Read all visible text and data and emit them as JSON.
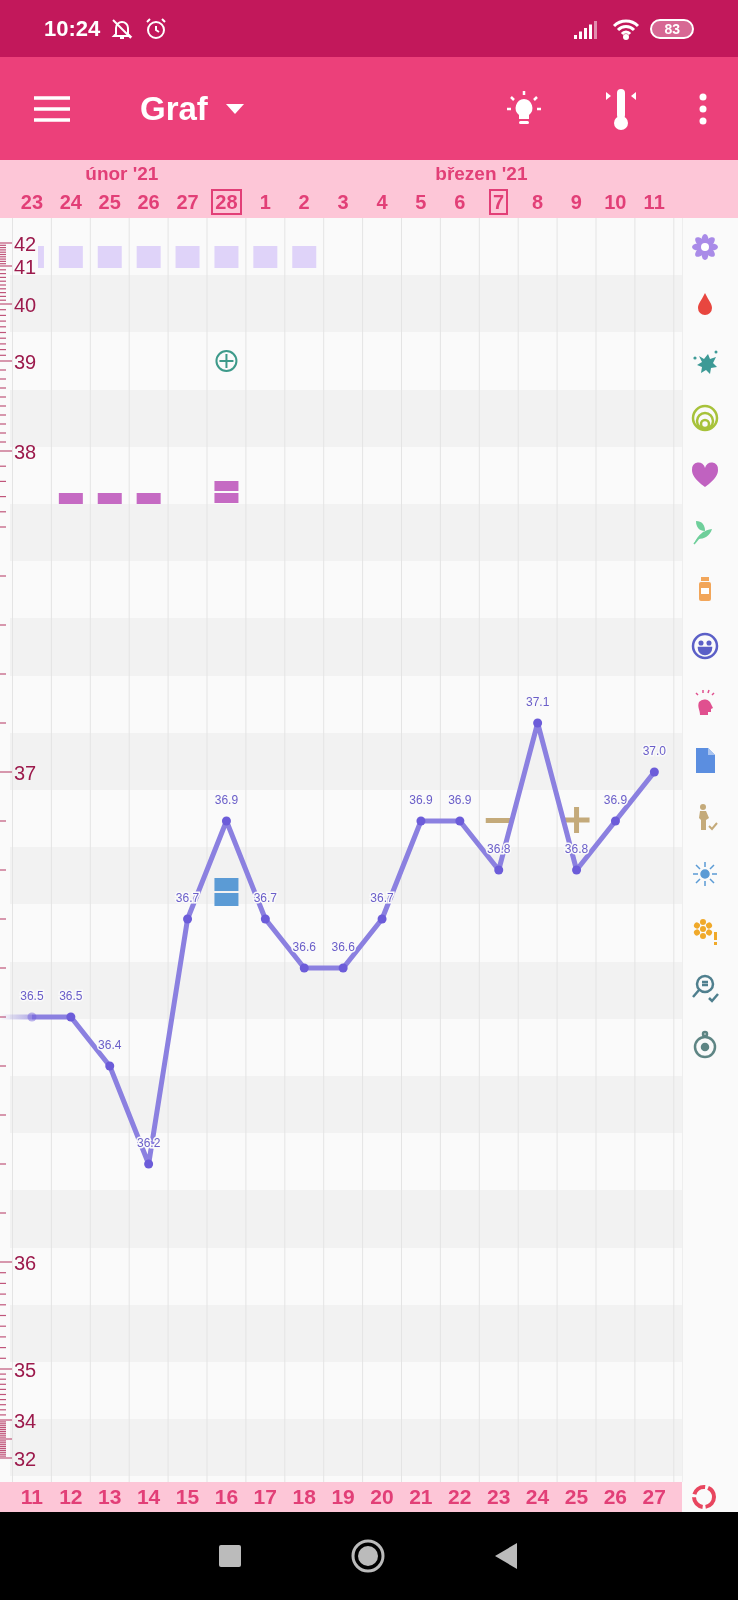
{
  "status_bar": {
    "time": "10:24",
    "battery": "83"
  },
  "app_bar": {
    "title": "Graf"
  },
  "chart": {
    "days": [
      {
        "date": "23",
        "highlighted": false,
        "symbols": [
          {
            "kind": "square"
          }
        ]
      },
      {
        "date": "24",
        "highlighted": false,
        "symbols": [
          {
            "kind": "square"
          },
          {
            "kind": "bar"
          }
        ]
      },
      {
        "date": "25",
        "month": "únor '21",
        "highlighted": false,
        "symbols": [
          {
            "kind": "square"
          },
          {
            "kind": "bar"
          }
        ]
      },
      {
        "date": "26",
        "highlighted": false,
        "symbols": [
          {
            "kind": "square"
          },
          {
            "kind": "bar"
          }
        ]
      },
      {
        "date": "27",
        "highlighted": false,
        "symbols": [
          {
            "kind": "square"
          }
        ]
      },
      {
        "date": "28",
        "highlighted": true,
        "symbols": [
          {
            "kind": "square"
          },
          {
            "kind": "plus-circle"
          },
          {
            "kind": "double-bar"
          },
          {
            "kind": "double-square"
          }
        ]
      },
      {
        "date": "1",
        "highlighted": false,
        "symbols": [
          {
            "kind": "square"
          }
        ]
      },
      {
        "date": "2",
        "highlighted": false,
        "symbols": [
          {
            "kind": "square"
          }
        ]
      },
      {
        "date": "3",
        "highlighted": false
      },
      {
        "date": "4",
        "highlighted": false
      },
      {
        "date": "5",
        "highlighted": false
      },
      {
        "date": "6",
        "month": "březen '21",
        "highlighted": false
      },
      {
        "date": "7",
        "highlighted": true,
        "symbols": [
          {
            "kind": "minus"
          }
        ]
      },
      {
        "date": "8",
        "highlighted": false
      },
      {
        "date": "9",
        "highlighted": false,
        "symbols": [
          {
            "kind": "plus"
          }
        ]
      },
      {
        "date": "10",
        "highlighted": false
      },
      {
        "date": "11",
        "highlighted": false
      }
    ],
    "temperature_labels": [
      "42",
      "41",
      "40",
      "39",
      "38",
      "37",
      "36",
      "35",
      "34",
      "32"
    ],
    "chart_data": {
      "type": "line",
      "marker": "circle",
      "categories": [
        "11",
        "12",
        "13",
        "14",
        "15",
        "16",
        "17",
        "18",
        "19",
        "20",
        "21",
        "22",
        "23",
        "24",
        "25",
        "26",
        "27"
      ],
      "values": [
        36.5,
        36.5,
        36.4,
        36.2,
        36.7,
        36.9,
        36.7,
        36.6,
        36.6,
        36.7,
        36.9,
        36.9,
        36.8,
        37.1,
        36.8,
        36.9,
        37.0
      ],
      "value_labels": [
        "36.5",
        "36.5",
        "36.4",
        "36.2",
        "36.7",
        "36.9",
        "36.7",
        "36.6",
        "36.6",
        "36.7",
        "36.9",
        "36.9",
        "36.8",
        "37.1",
        "36.8",
        "36.9",
        "37.0"
      ]
    }
  }
}
